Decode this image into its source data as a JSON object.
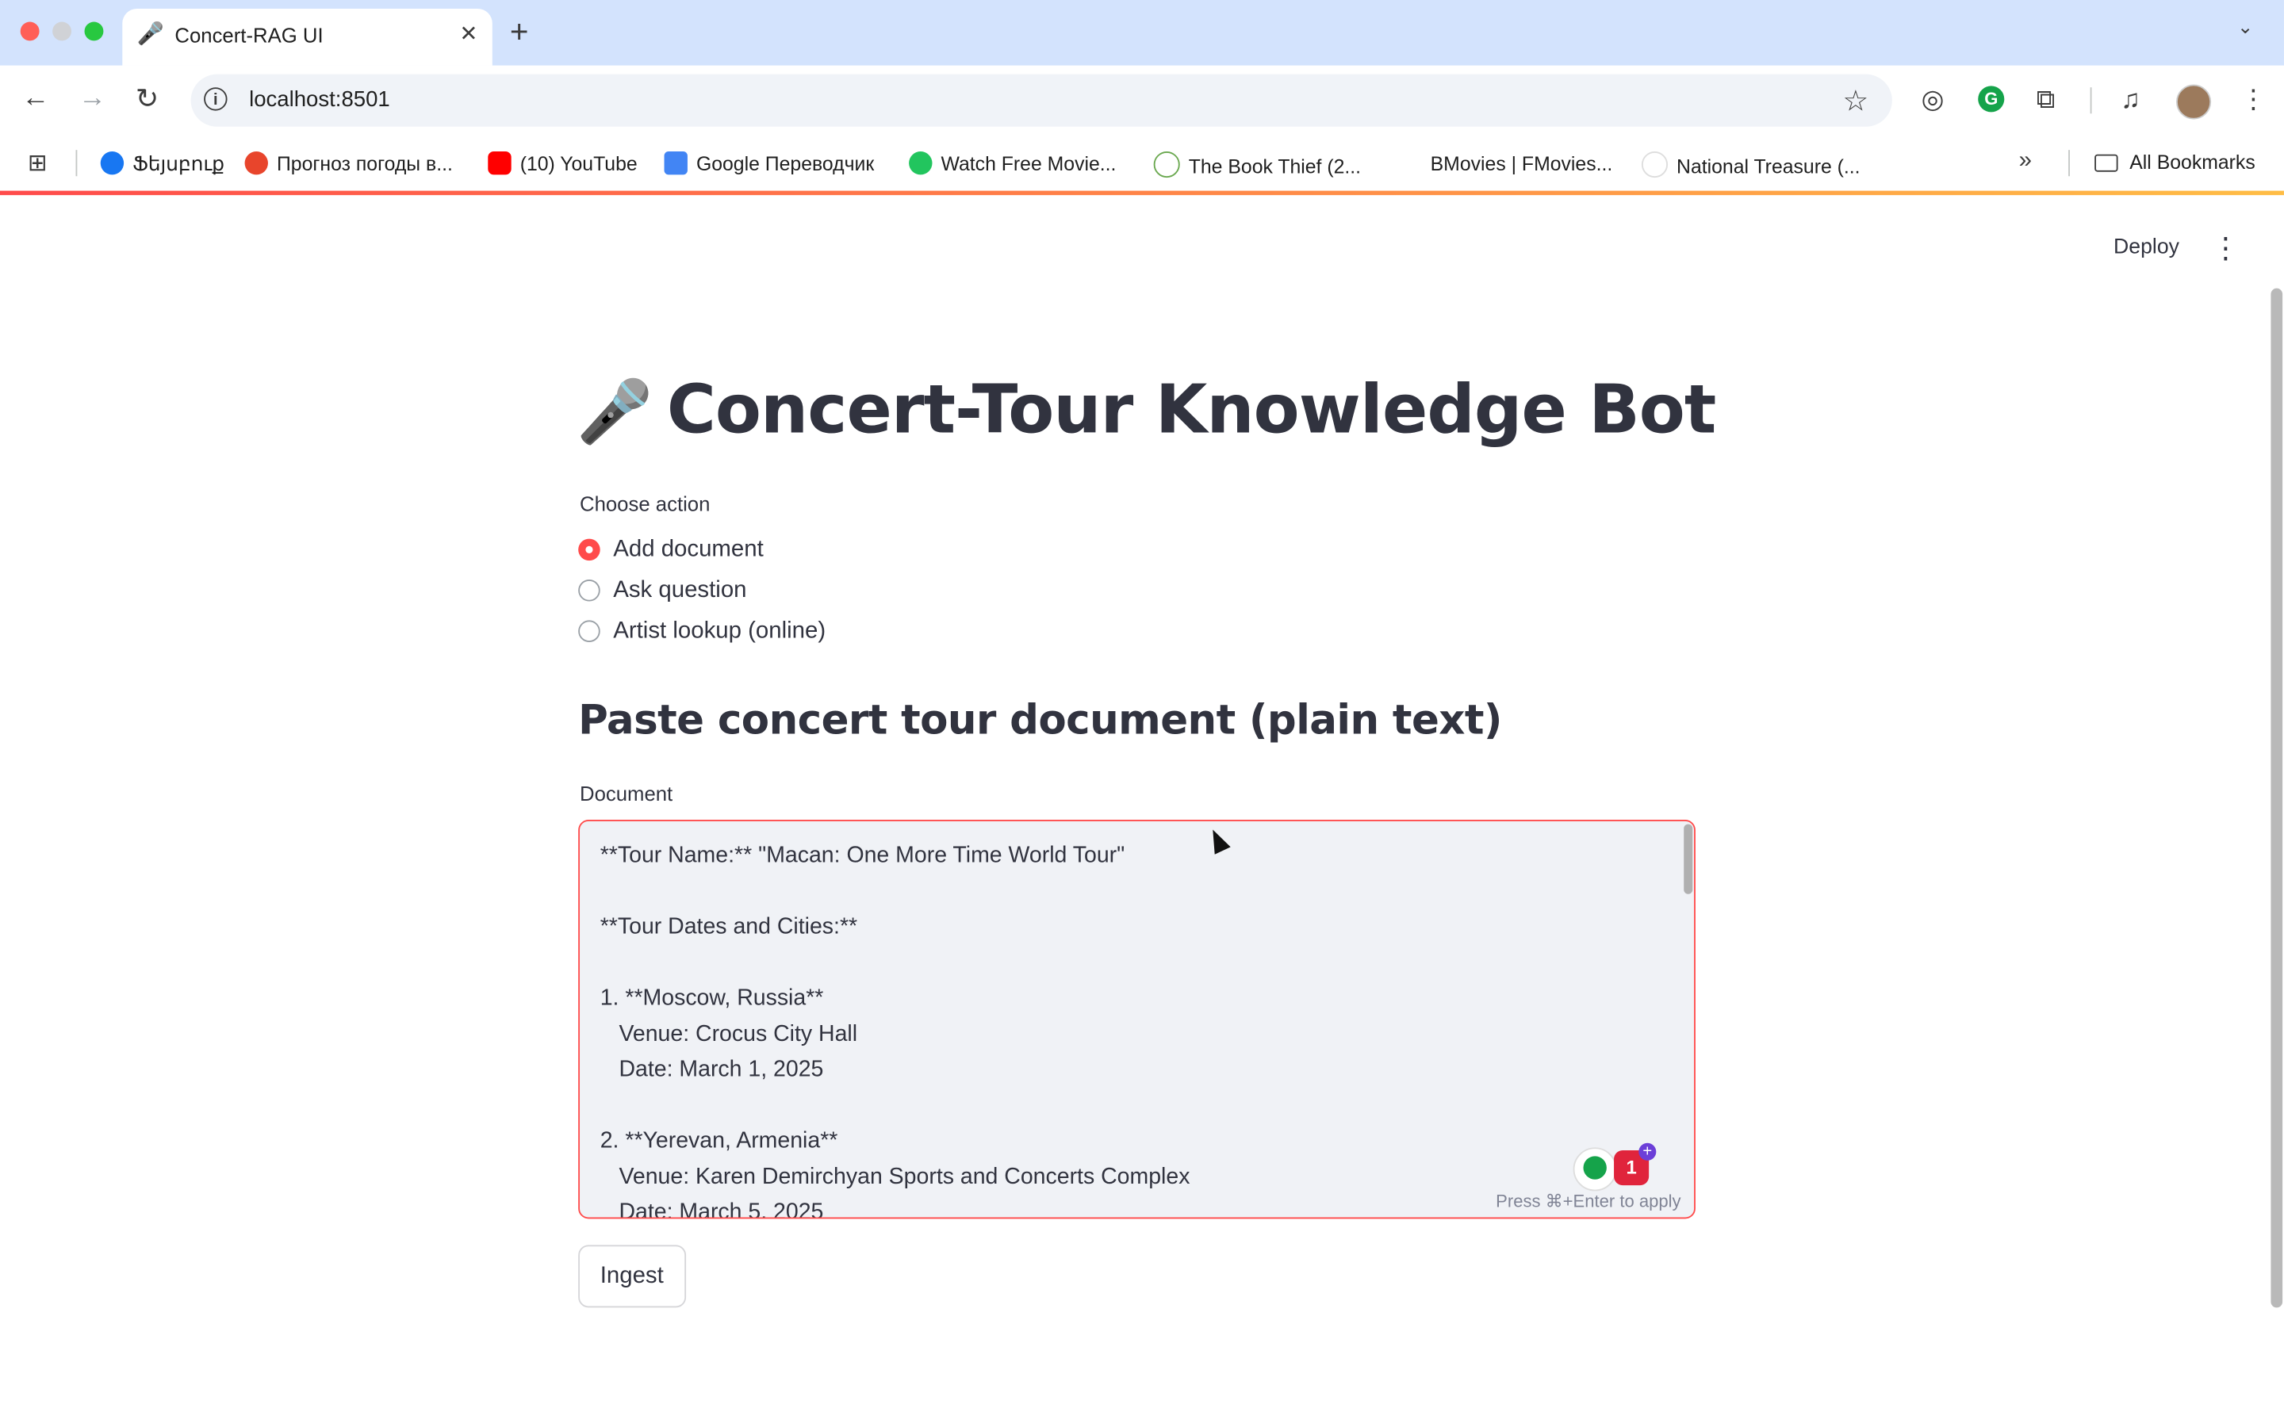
{
  "browser": {
    "tab": {
      "icon": "microphone-icon",
      "icon_glyph": "🎤",
      "title": "Concert-RAG UI"
    },
    "url": "localhost:8501",
    "bookmarks": [
      {
        "label": "Ֆեյսբուք",
        "color": "#1877f2"
      },
      {
        "label": "Прогноз погоды в...",
        "color": "#e8452c"
      },
      {
        "label": "(10) YouTube",
        "color": "#ff0000"
      },
      {
        "label": "Google Переводчик",
        "color": "#4285f4"
      },
      {
        "label": "Watch Free Movie...",
        "color": "#22c55e"
      },
      {
        "label": "The Book Thief (2...",
        "color": "#6aa84f"
      },
      {
        "label": "BMovies | FMovies...",
        "color": "#ffffff"
      },
      {
        "label": "National Treasure (...",
        "color": "#e0e0e0"
      }
    ],
    "all_bookmarks": "All Bookmarks"
  },
  "app": {
    "deploy": "Deploy",
    "title_icon": "🎤",
    "title": "Concert-Tour Knowledge Bot",
    "choose_label": "Choose action",
    "options": [
      "Add document",
      "Ask question",
      "Artist lookup (online)"
    ],
    "selected": "Add document",
    "subheader": "Paste concert tour document (plain text)",
    "doc_label": "Document",
    "document_text": "**Tour Name:** \"Macan: One More Time World Tour\"\n\n**Tour Dates and Cities:**\n\n1. **Moscow, Russia**\n   Venue: Crocus City Hall\n   Date: March 1, 2025\n\n2. **Yerevan, Armenia**\n   Venue: Karen Demirchyan Sports and Concerts Complex\n   Date: March 5, 2025",
    "hint": "Press ⌘+Enter to apply",
    "grammarly_count": "1",
    "ingest": "Ingest"
  },
  "colors": {
    "accent": "#ff4b4b",
    "text": "#31333f",
    "tabstrip": "#d3e3fd"
  }
}
